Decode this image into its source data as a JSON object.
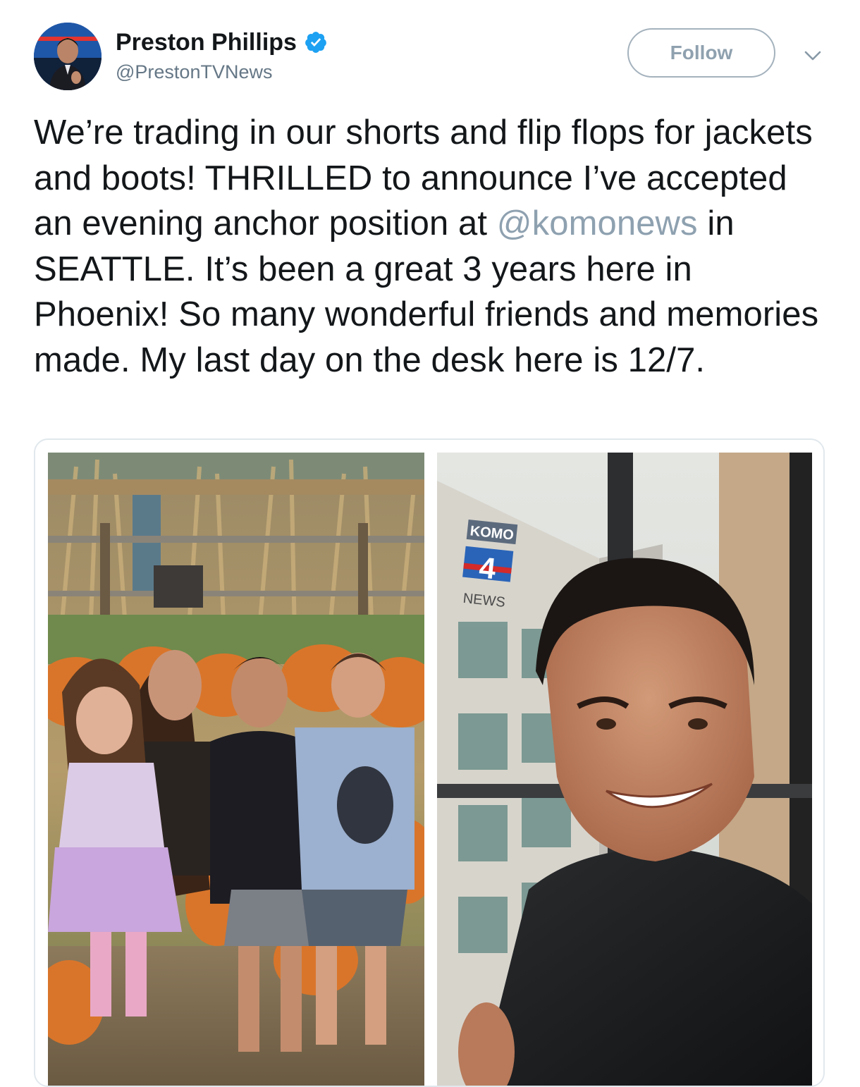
{
  "author": {
    "display_name": "Preston Phillips",
    "handle": "@PrestonTVNews",
    "verified": true,
    "verified_color": "#1da1f2"
  },
  "actions": {
    "follow_label": "Follow",
    "menu_icon": "chevron-down-icon"
  },
  "tweet": {
    "text_before_mention": "We’re trading in our shorts and flip flops for jackets and boots! THRILLED to announce I’ve accepted an evening anchor position at ",
    "mention": "@komonews",
    "text_after_mention": " in SEATTLE. It’s been a great 3 years here in Phoenix! So many wonderful friends and memories made. My last day on the desk here is 12/7.",
    "mention_color": "#8ea1b0"
  },
  "media": {
    "photo_left_sign": "",
    "photo_right_sign_top": "KOMO",
    "photo_right_sign_number": "4",
    "photo_right_sign_bottom": "NEWS"
  }
}
